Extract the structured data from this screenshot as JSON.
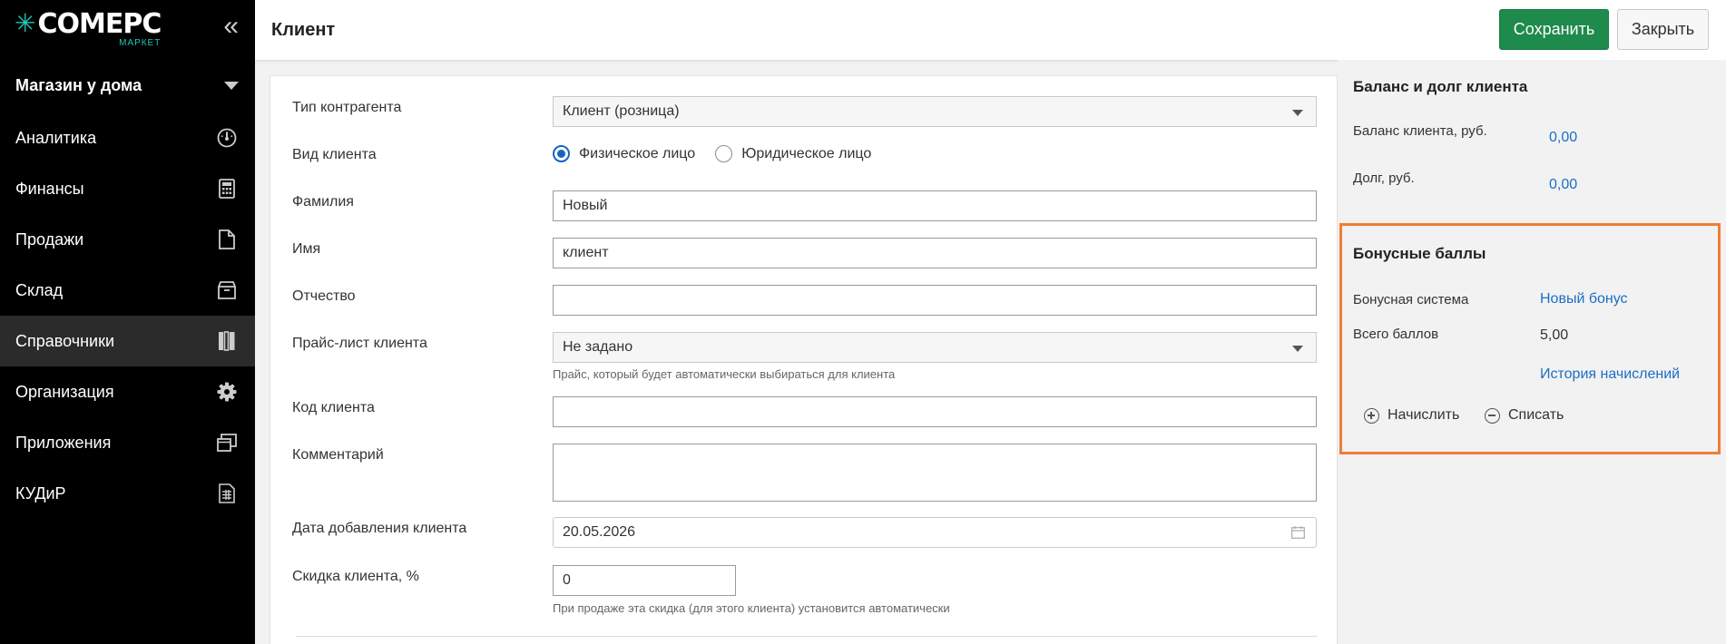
{
  "brand": {
    "name": "COMEPC",
    "sub": "МАРКЕТ",
    "accent": "#1fc6b6"
  },
  "sidebar": {
    "collapse_glyph": "«",
    "store": "Магазин у дома",
    "items": [
      {
        "label": "Аналитика",
        "icon": "gauge-icon"
      },
      {
        "label": "Финансы",
        "icon": "calculator-icon"
      },
      {
        "label": "Продажи",
        "icon": "document-icon"
      },
      {
        "label": "Склад",
        "icon": "box-icon"
      },
      {
        "label": "Справочники",
        "icon": "books-icon",
        "active": true
      },
      {
        "label": "Организация",
        "icon": "gear-icon"
      },
      {
        "label": "Приложения",
        "icon": "windows-icon"
      },
      {
        "label": "КУДиР",
        "icon": "ledger-icon"
      }
    ]
  },
  "header": {
    "title": "Клиент",
    "save_label": "Сохранить",
    "close_label": "Закрыть"
  },
  "form": {
    "type_label": "Тип контрагента",
    "type_value": "Клиент (розница)",
    "kind_label": "Вид клиента",
    "kind_options": [
      "Физическое лицо",
      "Юридическое лицо"
    ],
    "kind_selected": "Физическое лицо",
    "lastname_label": "Фамилия",
    "lastname_value": "Новый",
    "firstname_label": "Имя",
    "firstname_value": "клиент",
    "middlename_label": "Отчество",
    "middlename_value": "",
    "pricelist_label": "Прайс-лист клиента",
    "pricelist_value": "Не задано",
    "pricelist_hint": "Прайс, который будет автоматически выбираться для клиента",
    "code_label": "Код клиента",
    "code_value": "",
    "comment_label": "Комментарий",
    "comment_value": "",
    "date_label": "Дата добавления клиента",
    "date_value": "20.05.2026",
    "discount_label": "Скидка клиента, %",
    "discount_value": "0",
    "discount_hint": "При продаже эта скидка (для этого клиента) установится автоматически"
  },
  "balance": {
    "title": "Баланс и долг клиента",
    "balance_label": "Баланс клиента, руб.",
    "balance_value": "0,00",
    "debt_label": "Долг, руб.",
    "debt_value": "0,00"
  },
  "bonus": {
    "title": "Бонусные баллы",
    "system_label": "Бонусная система",
    "system_value": "Новый бонус",
    "total_label": "Всего баллов",
    "total_value": "5,00",
    "history_link": "История начислений",
    "accrue_label": "Начислить",
    "writeoff_label": "Списать",
    "highlight_color": "#f07d36"
  }
}
